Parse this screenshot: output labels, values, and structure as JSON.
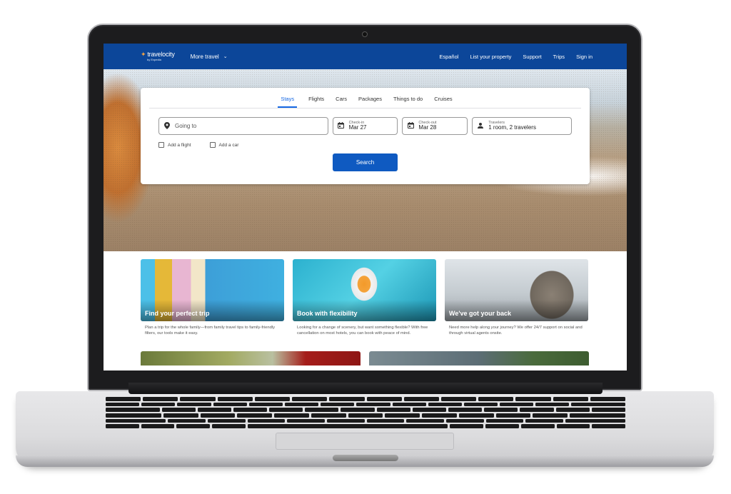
{
  "header": {
    "logo": {
      "brand": "travelocity",
      "sub": "by Expedia"
    },
    "more_travel": "More travel",
    "nav": [
      "Español",
      "List your property",
      "Support",
      "Trips",
      "Sign in"
    ]
  },
  "search": {
    "tabs": [
      {
        "label": "Stays",
        "active": true
      },
      {
        "label": "Flights",
        "active": false
      },
      {
        "label": "Cars",
        "active": false
      },
      {
        "label": "Packages",
        "active": false
      },
      {
        "label": "Things to do",
        "active": false
      },
      {
        "label": "Cruises",
        "active": false
      }
    ],
    "destination": {
      "placeholder": "Going to",
      "value": ""
    },
    "checkin": {
      "label": "Check-in",
      "value": "Mar 27"
    },
    "checkout": {
      "label": "Check-out",
      "value": "Mar 28"
    },
    "travelers": {
      "label": "Travelers",
      "value": "1 room, 2 travelers"
    },
    "options": [
      {
        "label": "Add a flight",
        "checked": false
      },
      {
        "label": "Add a car",
        "checked": false
      }
    ],
    "button": "Search"
  },
  "promos": [
    {
      "title": "Find your perfect trip",
      "text": "Plan a trip for the whole family—from family travel tips to family-friendly filters, our tools make it easy."
    },
    {
      "title": "Book with flexibility",
      "text": "Looking for a change of scenery, but want something flexible? With free cancellation on most hotels, you can book with peace of mind."
    },
    {
      "title": "We've got your back",
      "text": "Need more help along your journey? We offer 24/7 support on social and through virtual agents onsite."
    }
  ],
  "icons": {
    "location": "map-pin-icon",
    "calendar": "calendar-icon",
    "person": "person-icon",
    "chevron": "chevron-down-icon"
  },
  "colors": {
    "brand_nav": "#0c4699",
    "accent": "#1668e3",
    "search_button": "#0f5ac1"
  }
}
